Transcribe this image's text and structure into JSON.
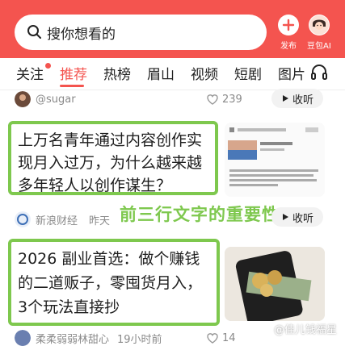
{
  "search": {
    "placeholder": "搜你想看的",
    "icon": "search-icon"
  },
  "header_actions": [
    {
      "label": "发布",
      "icon": "plus-icon"
    },
    {
      "label": "豆包AI",
      "icon": "avatar-icon"
    }
  ],
  "tabs": [
    {
      "label": "关注",
      "has_dot": true,
      "active": false
    },
    {
      "label": "推荐",
      "has_dot": false,
      "active": true
    },
    {
      "label": "热榜",
      "has_dot": false,
      "active": false
    },
    {
      "label": "眉山",
      "has_dot": false,
      "active": false
    },
    {
      "label": "视频",
      "has_dot": false,
      "active": false
    },
    {
      "label": "短剧",
      "has_dot": false,
      "active": false
    },
    {
      "label": "图片",
      "has_dot": false,
      "active": false
    }
  ],
  "top_item": {
    "author": "@sugar",
    "likes": "239",
    "collect_label": "收听"
  },
  "article1": {
    "title": "上万名青年通过内容创作实现月入过万，为什么越来越多年轻人以创作谋生？",
    "source": "新浪财经",
    "time": "昨天"
  },
  "annotation": "前三行文字的重要性",
  "article2": {
    "title": "2026 副业首选：做个赚钱的二道贩子，零囤货月入，3个玩法直接抄",
    "author": "柔柔弱弱林甜心",
    "time": "19小时前",
    "likes": "14"
  },
  "watermark": "@佳儿钱福星",
  "colors": {
    "brand": "#f4544f",
    "highlight": "#7ec84e"
  }
}
